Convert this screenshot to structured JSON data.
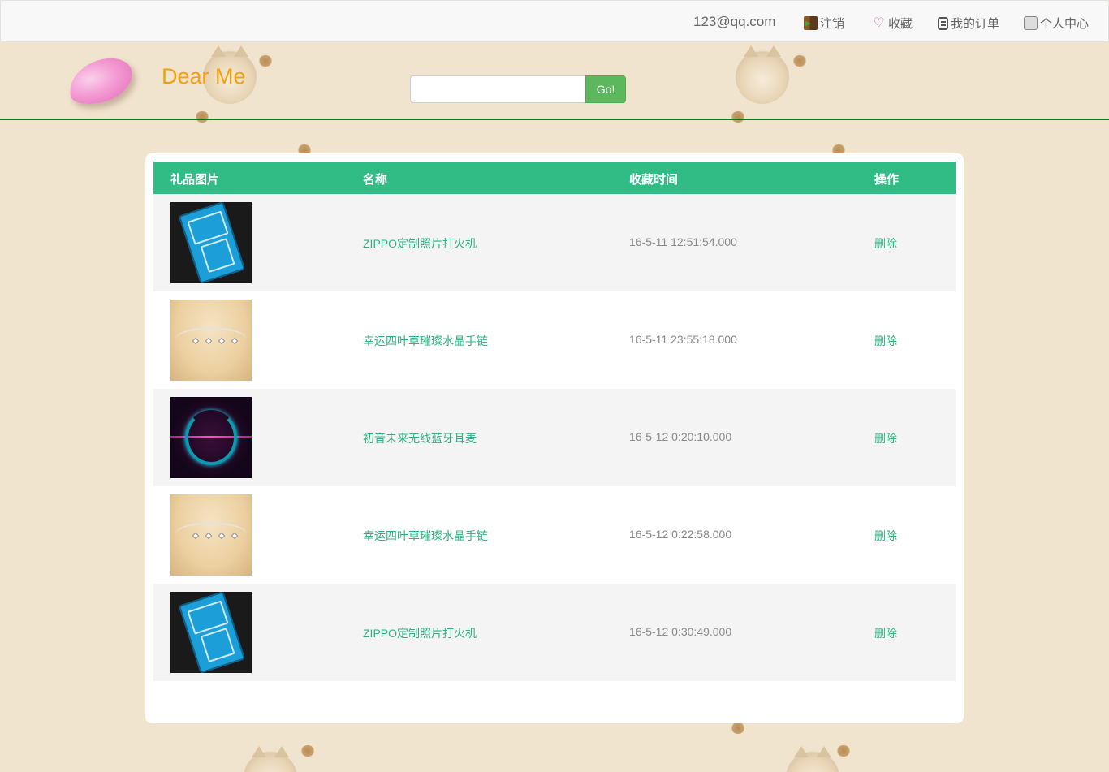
{
  "topbar": {
    "user_email": "123@qq.com",
    "nav": [
      {
        "label": "注销",
        "icon": "logout-icon"
      },
      {
        "label": "收藏",
        "icon": "favorite-icon"
      },
      {
        "label": "我的订单",
        "icon": "order-icon"
      },
      {
        "label": "个人中心",
        "icon": "user-center-icon"
      }
    ]
  },
  "header": {
    "brand": "Dear Me",
    "search": {
      "value": "",
      "placeholder": ""
    },
    "go_label": "Go!"
  },
  "favorites_table": {
    "headers": [
      "礼品图片",
      "名称",
      "收藏时间",
      "操作"
    ],
    "rows": [
      {
        "image": "zippo-lighter-thumbnail",
        "name": "ZIPPO定制照片打火机",
        "time": "16-5-11 12:51:54.000",
        "action": "删除"
      },
      {
        "image": "bracelet-thumbnail",
        "name": "幸运四叶草璀璨水晶手链",
        "time": "16-5-11 23:55:18.000",
        "action": "删除"
      },
      {
        "image": "headset-thumbnail",
        "name": "初音未来无线蓝牙耳麦",
        "time": "16-5-12 0:20:10.000",
        "action": "删除"
      },
      {
        "image": "bracelet-thumbnail",
        "name": "幸运四叶草璀璨水晶手链",
        "time": "16-5-12 0:22:58.000",
        "action": "删除"
      },
      {
        "image": "zippo-lighter-thumbnail",
        "name": "ZIPPO定制照片打火机",
        "time": "16-5-12 0:30:49.000",
        "action": "删除"
      }
    ]
  },
  "colors": {
    "brand": "#f5a00a",
    "table_header": "#31bc86",
    "link": "#2fb07e",
    "go_button": "#5cb85c",
    "header_rule": "#0c7a0c",
    "background": "#f1e4cf"
  }
}
